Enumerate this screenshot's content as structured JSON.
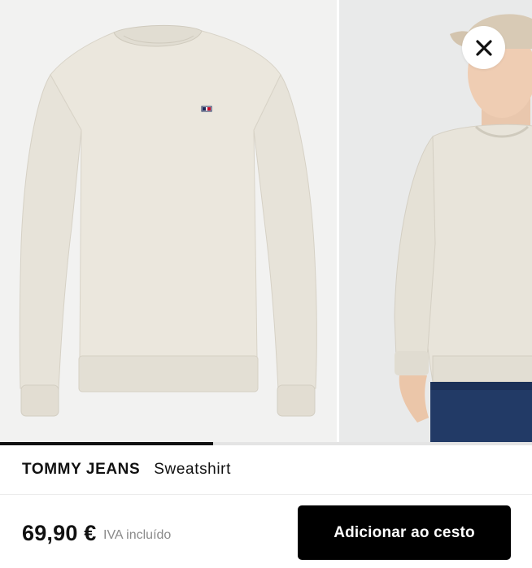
{
  "gallery": {
    "images": [
      {
        "icon": "sweatshirt-product-image"
      },
      {
        "icon": "model-wearing-sweatshirt-image"
      }
    ],
    "progress": 0.4,
    "close_icon": "close-icon"
  },
  "product": {
    "brand": "TOMMY JEANS",
    "name": "Sweatshirt",
    "price": "69,90 €",
    "vat_note": "IVA incluído"
  },
  "actions": {
    "add_to_cart_label": "Adicionar ao cesto"
  },
  "colors": {
    "sweatshirt": "#e8e4da",
    "button": "#000000",
    "progress": "#111111"
  }
}
